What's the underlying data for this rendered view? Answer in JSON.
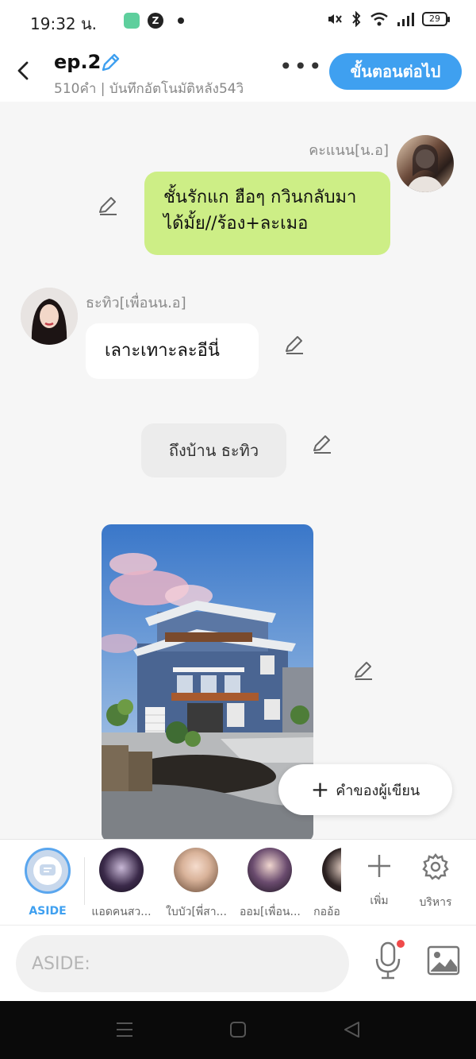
{
  "status_bar": {
    "time": "19:32 น.",
    "battery": "29"
  },
  "header": {
    "title": "ep.2",
    "subtitle": "510คำ | บันทึกอัตโนมัติหลัง54วิ",
    "more_label": "•••",
    "next_button": "ขั้นตอนต่อไป"
  },
  "chat": {
    "messages": [
      {
        "sender": "คะแนน[น.อ]",
        "text": "ชั้นรักแก ฮือๆ กวินกลับมาได้มั้ย//ร้อง+ละเมอ",
        "side": "right"
      },
      {
        "sender": "ธะทิว[เพื่อนน.อ]",
        "text": "เลาะเทาะละอีนี่",
        "side": "left"
      },
      {
        "sender": "",
        "text": "ถึงบ้าน ธะทิว",
        "side": "center"
      }
    ],
    "author_button": "คำของผู้เขียน"
  },
  "character_bar": {
    "characters": [
      {
        "label": "ASIDE"
      },
      {
        "label": "แอดคนสว..."
      },
      {
        "label": "ใบบัว[พี่สา..."
      },
      {
        "label": "ออม[เพื่อน..."
      },
      {
        "label": "กออ้อ"
      }
    ],
    "add_label": "เพิ่ม",
    "manage_label": "บริหาร"
  },
  "input": {
    "placeholder": "ASIDE:"
  },
  "colors": {
    "accent": "#3fa0f0",
    "green_bubble": "#cdee86",
    "notification_dot": "#f04a4a"
  }
}
